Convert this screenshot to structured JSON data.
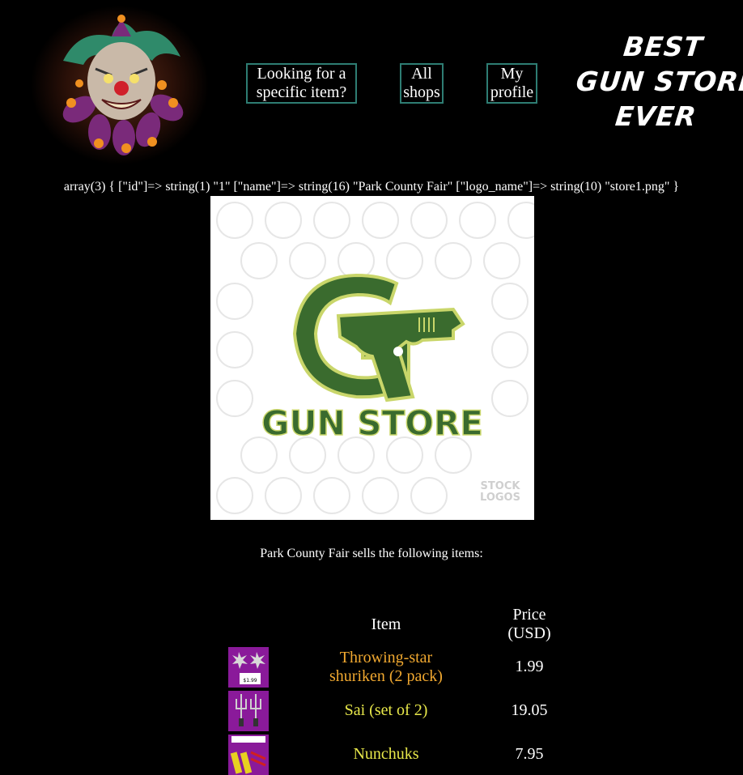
{
  "header": {
    "nav": [
      {
        "label_line1": "Looking for a",
        "label_line2": "specific item?"
      },
      {
        "label_line1": "All",
        "label_line2": "shops"
      },
      {
        "label_line1": "My",
        "label_line2": "profile"
      }
    ],
    "brand_lines": [
      "BEST",
      "GUN STORE",
      "EVER"
    ]
  },
  "debug_dump": "array(3) { [\"id\"]=> string(1) \"1\" [\"name\"]=> string(16) \"Park County Fair\" [\"logo_name\"]=> string(10) \"store1.png\" }",
  "store_logo": {
    "text": "GUN STORE",
    "watermark_line1": "STOCK",
    "watermark_line2": "LOGOS",
    "green": "#3a6b2e",
    "accent": "#c9d66a"
  },
  "sells_text": "Park County Fair sells the following items:",
  "table": {
    "col_item": "Item",
    "col_price_line1": "Price",
    "col_price_line2": "(USD)",
    "rows": [
      {
        "name_line1": "Throwing-star",
        "name_line2": "shuriken (2 pack)",
        "price": "1.99",
        "color": "#f0a830",
        "thumb_label": "$1.99"
      },
      {
        "name_line1": "Sai (set of 2)",
        "name_line2": "",
        "price": "19.05",
        "color": "#e8e84a",
        "thumb_label": ""
      },
      {
        "name_line1": "Nunchuks",
        "name_line2": "",
        "price": "7.95",
        "color": "#e8e84a",
        "thumb_label": ""
      }
    ]
  }
}
